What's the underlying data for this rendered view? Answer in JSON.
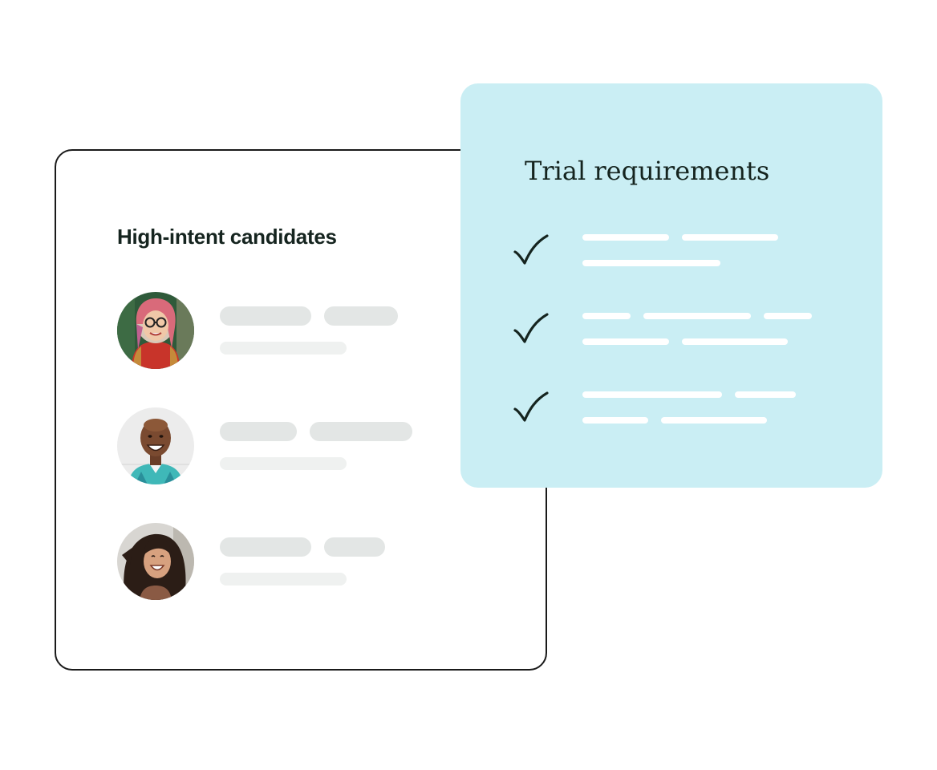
{
  "candidates_card": {
    "title": "High-intent candidates",
    "candidates": [
      {
        "avatar": "avatar-woman-glasses-icon"
      },
      {
        "avatar": "avatar-man-smiling-icon"
      },
      {
        "avatar": "avatar-woman-laughing-icon"
      }
    ]
  },
  "requirements_card": {
    "title": "Trial requirements",
    "items": [
      {
        "icon": "checkmark-icon"
      },
      {
        "icon": "checkmark-icon"
      },
      {
        "icon": "checkmark-icon"
      }
    ]
  },
  "colors": {
    "requirements_background": "#caeef4",
    "card_border": "#1a1a1a",
    "placeholder": "#e3e6e5",
    "placeholder_light": "#eff1f0",
    "text": "#15241f"
  }
}
